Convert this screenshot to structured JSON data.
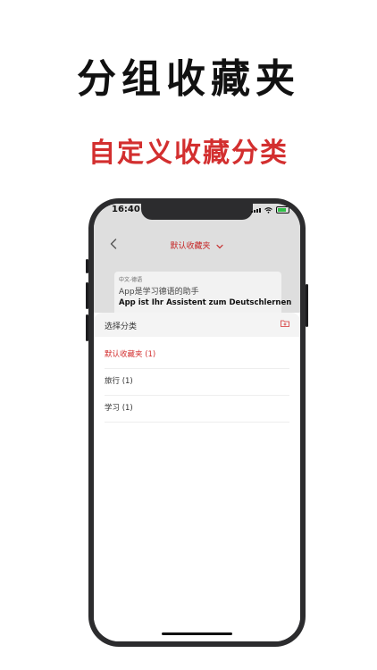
{
  "promo": {
    "headline": "分组收藏夹",
    "subline": "自定义收藏分类",
    "accent_color": "#d32f2f"
  },
  "status_bar": {
    "time": "16:40"
  },
  "nav": {
    "back_icon": "chevron-left-icon",
    "title": "默认收藏夹",
    "dropdown_icon": "chevron-down-icon"
  },
  "card": {
    "lang_pair": "中文-德语",
    "source_text": "App是学习德语的助手",
    "target_text": "App ist Ihr Assistent zum Deutschlernen"
  },
  "sheet": {
    "title": "选择分类",
    "add_icon": "folder-add-icon",
    "options": [
      {
        "label": "默认收藏夹 (1)",
        "selected": true
      },
      {
        "label": "旅行 (1)",
        "selected": false
      },
      {
        "label": "学习 (1)",
        "selected": false
      }
    ]
  }
}
